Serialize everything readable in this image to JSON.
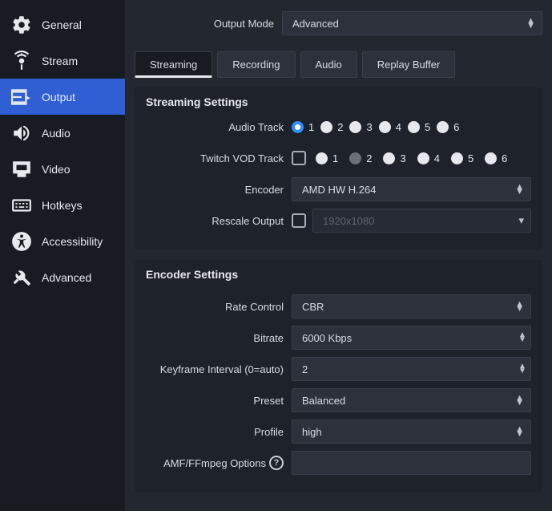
{
  "sidebar": {
    "items": [
      {
        "label": "General"
      },
      {
        "label": "Stream"
      },
      {
        "label": "Output"
      },
      {
        "label": "Audio"
      },
      {
        "label": "Video"
      },
      {
        "label": "Hotkeys"
      },
      {
        "label": "Accessibility"
      },
      {
        "label": "Advanced"
      }
    ],
    "active_index": 2
  },
  "output_mode": {
    "label": "Output Mode",
    "value": "Advanced"
  },
  "tabs": [
    {
      "label": "Streaming"
    },
    {
      "label": "Recording"
    },
    {
      "label": "Audio"
    },
    {
      "label": "Replay Buffer"
    }
  ],
  "active_tab": 0,
  "streaming": {
    "title": "Streaming Settings",
    "audio_track": {
      "label": "Audio Track",
      "options": [
        "1",
        "2",
        "3",
        "4",
        "5",
        "6"
      ],
      "selected": 0
    },
    "twitch_vod": {
      "label": "Twitch VOD Track",
      "checked": false,
      "disabled_index": 1,
      "options": [
        "1",
        "2",
        "3",
        "4",
        "5",
        "6"
      ]
    },
    "encoder": {
      "label": "Encoder",
      "value": "AMD HW H.264"
    },
    "rescale": {
      "label": "Rescale Output",
      "checked": false,
      "value": "1920x1080"
    }
  },
  "encoder": {
    "title": "Encoder Settings",
    "rate_control": {
      "label": "Rate Control",
      "value": "CBR"
    },
    "bitrate": {
      "label": "Bitrate",
      "value": "6000 Kbps"
    },
    "keyframe": {
      "label": "Keyframe Interval (0=auto)",
      "value": "2"
    },
    "preset": {
      "label": "Preset",
      "value": "Balanced"
    },
    "profile": {
      "label": "Profile",
      "value": "high"
    },
    "amf": {
      "label": "AMF/FFmpeg Options"
    }
  }
}
